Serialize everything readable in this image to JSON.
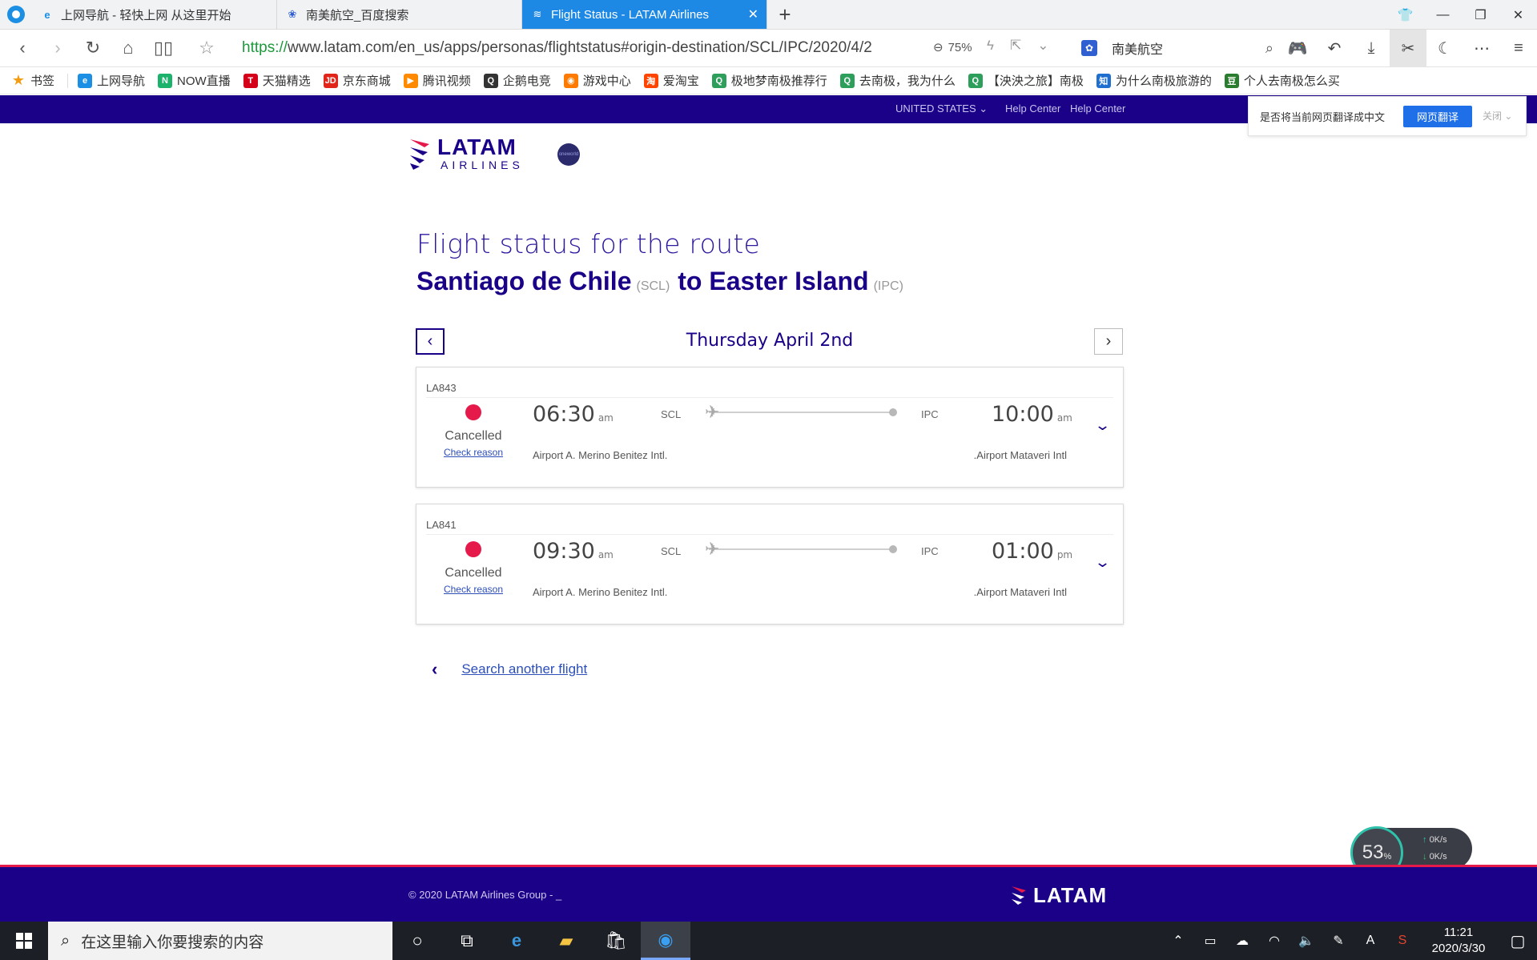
{
  "browser": {
    "tabs": [
      {
        "label": "上网导航 - 轻快上网 从这里开始",
        "icon": "ie-icon",
        "active": false
      },
      {
        "label": "南美航空_百度搜索",
        "icon": "baidu-paw-icon",
        "active": false
      },
      {
        "label": "Flight Status - LATAM Airlines",
        "icon": "latam-icon",
        "active": true
      }
    ],
    "url_scheme": "https://",
    "url_rest": "www.latam.com/en_us/apps/personas/flightstatus#origin-destination/SCL/IPC/2020/4/2",
    "zoom": "75%",
    "search_text": "南美航空",
    "bookmarks": [
      {
        "label": "书签",
        "color": "#f39c12",
        "glyph": "★"
      },
      {
        "label": "上网导航",
        "color": "#1a8fe3",
        "glyph": "e"
      },
      {
        "label": "NOW直播",
        "color": "#1bb36b",
        "glyph": "N"
      },
      {
        "label": "天猫精选",
        "color": "#d4001a",
        "glyph": "T"
      },
      {
        "label": "京东商城",
        "color": "#e1251b",
        "glyph": "JD"
      },
      {
        "label": "腾讯视频",
        "color": "#ff8a00",
        "glyph": "▶"
      },
      {
        "label": "企鹅电竞",
        "color": "#333333",
        "glyph": "Q"
      },
      {
        "label": "游戏中心",
        "color": "#ff7a00",
        "glyph": "◉"
      },
      {
        "label": "爱淘宝",
        "color": "#ff4400",
        "glyph": "淘"
      },
      {
        "label": "极地梦南极推荐行",
        "color": "#2e9e5b",
        "glyph": "Q"
      },
      {
        "label": "去南极，我为什么",
        "color": "#2e9e5b",
        "glyph": "Q"
      },
      {
        "label": "【泱泱之旅】南极",
        "color": "#2e9e5b",
        "glyph": "Q"
      },
      {
        "label": "为什么南极旅游的",
        "color": "#1f6fd1",
        "glyph": "知"
      },
      {
        "label": "个人去南极怎么买",
        "color": "#2a7d2e",
        "glyph": "豆"
      }
    ]
  },
  "translate_bar": {
    "prompt": "是否将当前网页翻译成中文",
    "button": "网页翻译",
    "close": "关闭"
  },
  "site": {
    "top_links": {
      "country": "UNITED STATES",
      "help1": "Help Center",
      "help2": "Help Center"
    },
    "logo_word": "LATAM",
    "logo_sub": "AIRLINES",
    "alliance": "oneworld",
    "heading": "Flight status for the route",
    "origin_city": "Santiago de Chile",
    "origin_code": "(SCL)",
    "connector": "to",
    "dest_city": "Easter Island",
    "dest_code": "(IPC)",
    "date": "Thursday April 2nd",
    "flights": [
      {
        "number": "LA843",
        "status": "Cancelled",
        "reason_link": "Check reason",
        "dep_time": "06:30",
        "dep_ampm": "am",
        "origin_code": "SCL",
        "dest_code": "IPC",
        "arr_time": "10:00",
        "arr_ampm": "am",
        "origin_airport": "Airport A. Merino Benitez Intl.",
        "dest_airport": ".Airport Mataveri Intl",
        "status_color": "#e6194b"
      },
      {
        "number": "LA841",
        "status": "Cancelled",
        "reason_link": "Check reason",
        "dep_time": "09:30",
        "dep_ampm": "am",
        "origin_code": "SCL",
        "dest_code": "IPC",
        "arr_time": "01:00",
        "arr_ampm": "pm",
        "origin_airport": "Airport A. Merino Benitez Intl.",
        "dest_airport": ".Airport Mataveri Intl",
        "status_color": "#e6194b"
      }
    ],
    "search_again": "Search another flight",
    "footer_copy": "© 2020 LATAM Airlines Group - _",
    "footer_logo": "LATAM",
    "colors": {
      "brand": "#1b0088",
      "accent": "#e6194b"
    }
  },
  "speed_widget": {
    "percent": "53",
    "unit": "%",
    "up": "0K/s",
    "down": "0K/s"
  },
  "taskbar": {
    "search_placeholder": "在这里输入你要搜索的内容",
    "time": "11:21",
    "date": "2020/3/30",
    "ime": "A"
  }
}
